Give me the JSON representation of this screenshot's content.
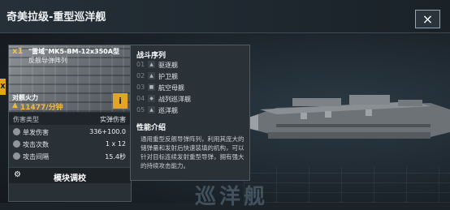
{
  "header": {
    "title": "奇美拉级-重型巡洋舰",
    "close_icon": "×"
  },
  "side_tab": {
    "label": "X"
  },
  "unit_card": {
    "count": "x1",
    "name": "\"雷域\"MK5-BM-12x350A型",
    "type": "反舰导弹阵列",
    "air_label": "对舰火力",
    "air_value": "11477/分钟",
    "info_icon": "i",
    "stats_header": {
      "left": "伤害类型",
      "right": "实弹伤害"
    },
    "stats": [
      {
        "label": "单发伤害",
        "value": "336+100.0"
      },
      {
        "label": "攻击次数",
        "value": "1 x 12"
      },
      {
        "label": "攻击间隔",
        "value": "15.4秒"
      }
    ],
    "tune_button": "模块调校"
  },
  "fleet": {
    "title": "战斗序列",
    "items": [
      {
        "index": "01",
        "label": "驱逐舰"
      },
      {
        "index": "02",
        "label": "护卫舰"
      },
      {
        "index": "03",
        "label": "航空母舰"
      },
      {
        "index": "04",
        "label": "战列巡洋舰"
      },
      {
        "index": "05",
        "label": "巡洋舰"
      }
    ]
  },
  "performance": {
    "title": "性能介绍",
    "text": "通用重型反舰导弹阵列，利用其庞大的储弹量和发射后快速装填的机构，可以针对目标连续发射重型导弹，拥有强大的持续攻击能力。"
  },
  "watermark": "巡洋舰"
}
